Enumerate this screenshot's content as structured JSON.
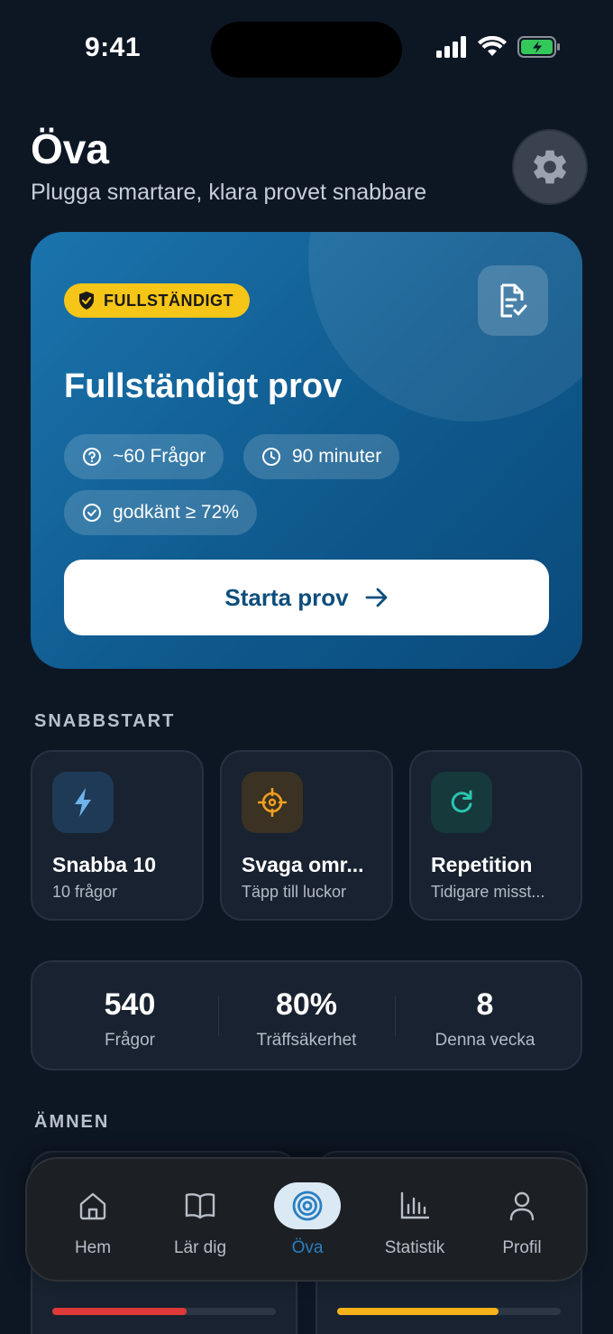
{
  "status_bar": {
    "time": "9:41"
  },
  "header": {
    "title": "Öva",
    "subtitle": "Plugga smartare, klara provet snabbare"
  },
  "hero": {
    "badge": "FULLSTÄNDIGT",
    "title": "Fullständigt prov",
    "chips": {
      "questions": "~60 Frågor",
      "duration": "90 minuter",
      "pass": "godkänt ≥ 72%"
    },
    "start_button": "Starta prov"
  },
  "quickstart": {
    "label": "SNABBSTART",
    "cards": [
      {
        "title": "Snabba 10",
        "subtitle": "10 frågor",
        "icon": "lightning-icon",
        "accent": "#6fb3ea"
      },
      {
        "title": "Svaga omr...",
        "subtitle": "Täpp till luckor",
        "icon": "crosshair-icon",
        "accent": "#f0a020"
      },
      {
        "title": "Repetition",
        "subtitle": "Tidigare misst...",
        "icon": "refresh-icon",
        "accent": "#2bc4b0"
      }
    ]
  },
  "stats": {
    "questions_value": "540",
    "questions_label": "Frågor",
    "accuracy_value": "80%",
    "accuracy_label": "Träffsäkerhet",
    "week_value": "8",
    "week_label": "Denna vecka"
  },
  "topics": {
    "label": "ÄMNEN",
    "cards": [
      {
        "progress": 0.6,
        "color": "#e0393a"
      },
      {
        "progress": 0.72,
        "color": "#f5b21a"
      }
    ]
  },
  "tabbar": {
    "tabs": [
      {
        "label": "Hem",
        "icon": "home-icon"
      },
      {
        "label": "Lär dig",
        "icon": "book-icon"
      },
      {
        "label": "Öva",
        "icon": "target-icon",
        "active": true
      },
      {
        "label": "Statistik",
        "icon": "chart-icon"
      },
      {
        "label": "Profil",
        "icon": "person-icon"
      }
    ]
  },
  "colors": {
    "background": "#0d1724",
    "card": "#182230",
    "accent": "#2a7fc1",
    "badge": "#f5c518"
  }
}
